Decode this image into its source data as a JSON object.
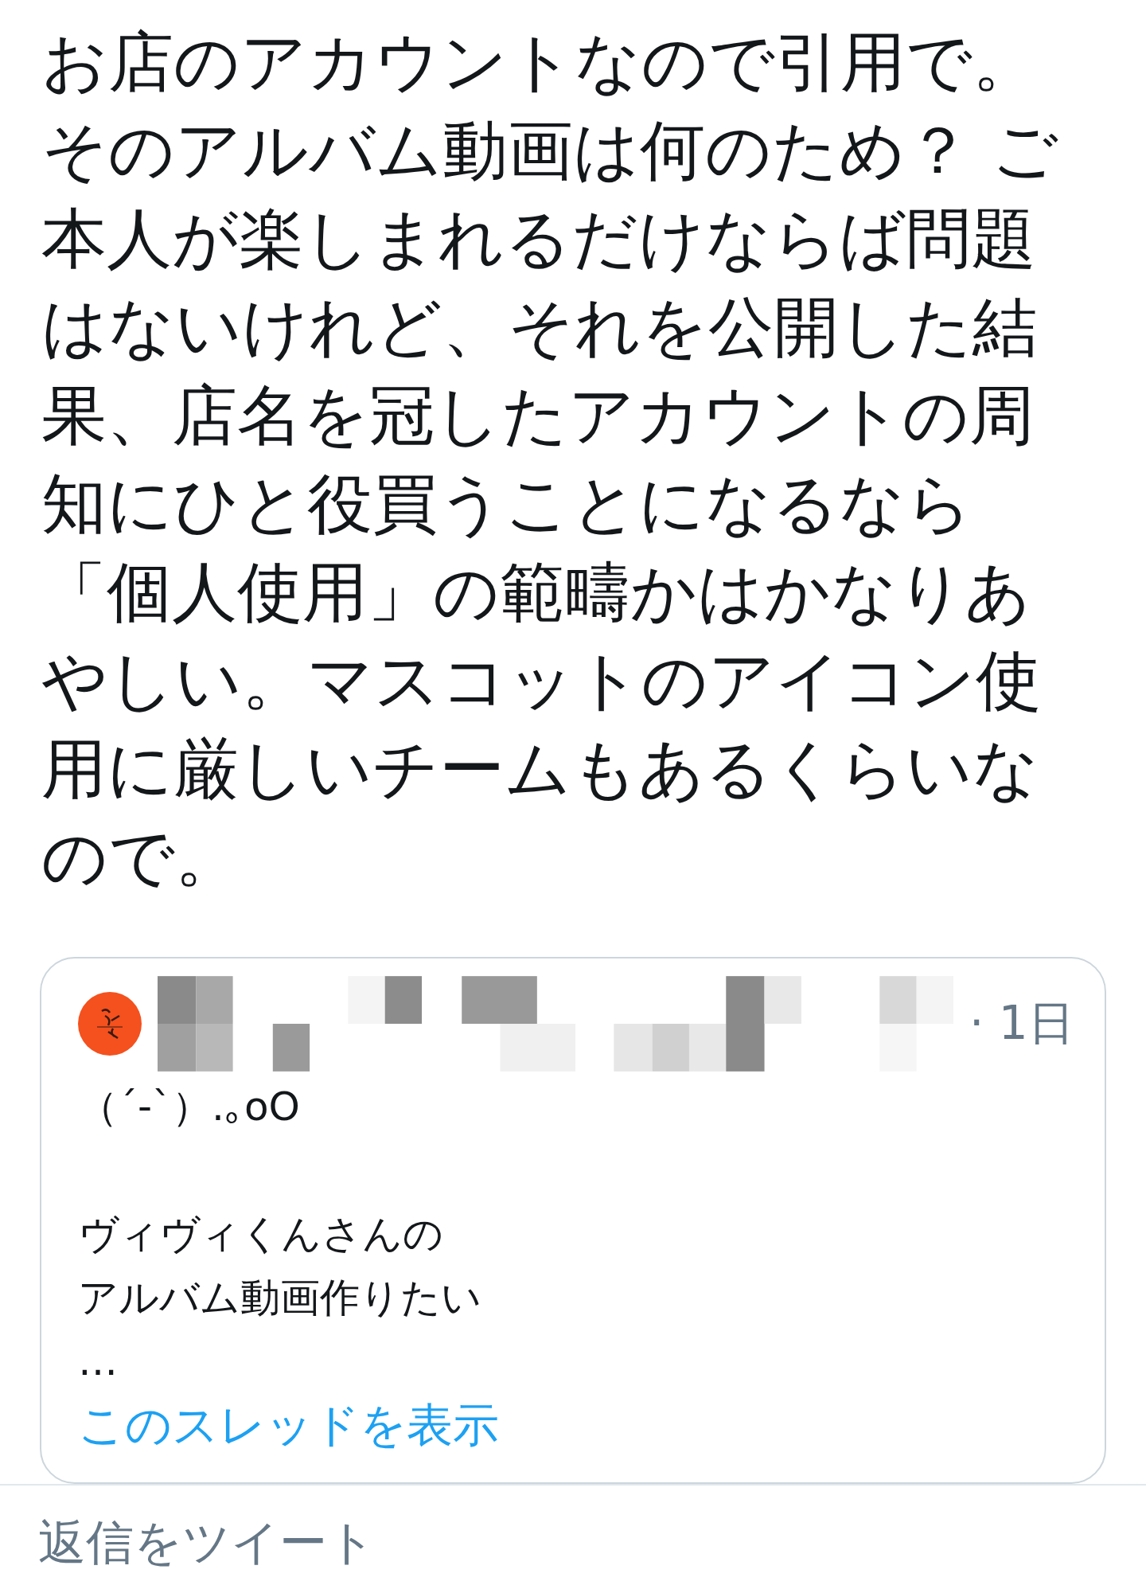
{
  "tweet": {
    "text_lines": [
      "お店のアカウントなので引用で。",
      "そのアルバム動画は何のため？ ご",
      "本人が楽しまれるだけならば問題",
      "はないけれど、それを公開した結",
      "果、店名を冠したアカウントの周",
      "知にひと役買うことになるなら",
      "「個人使用」の範疇かはかなりあ",
      "やしい。マスコットのアイコン使",
      "用に厳しいチームもあるくらいな",
      "ので。"
    ]
  },
  "quoted_tweet": {
    "time": "· 1日",
    "kaomoji": "（´-`）.｡oO",
    "lines": [
      "ヴィヴィくんさんの",
      "アルバム動画作りたい",
      "…"
    ],
    "show_thread": "このスレッドを表示"
  },
  "reply_field": {
    "placeholder": "返信をツイート"
  }
}
